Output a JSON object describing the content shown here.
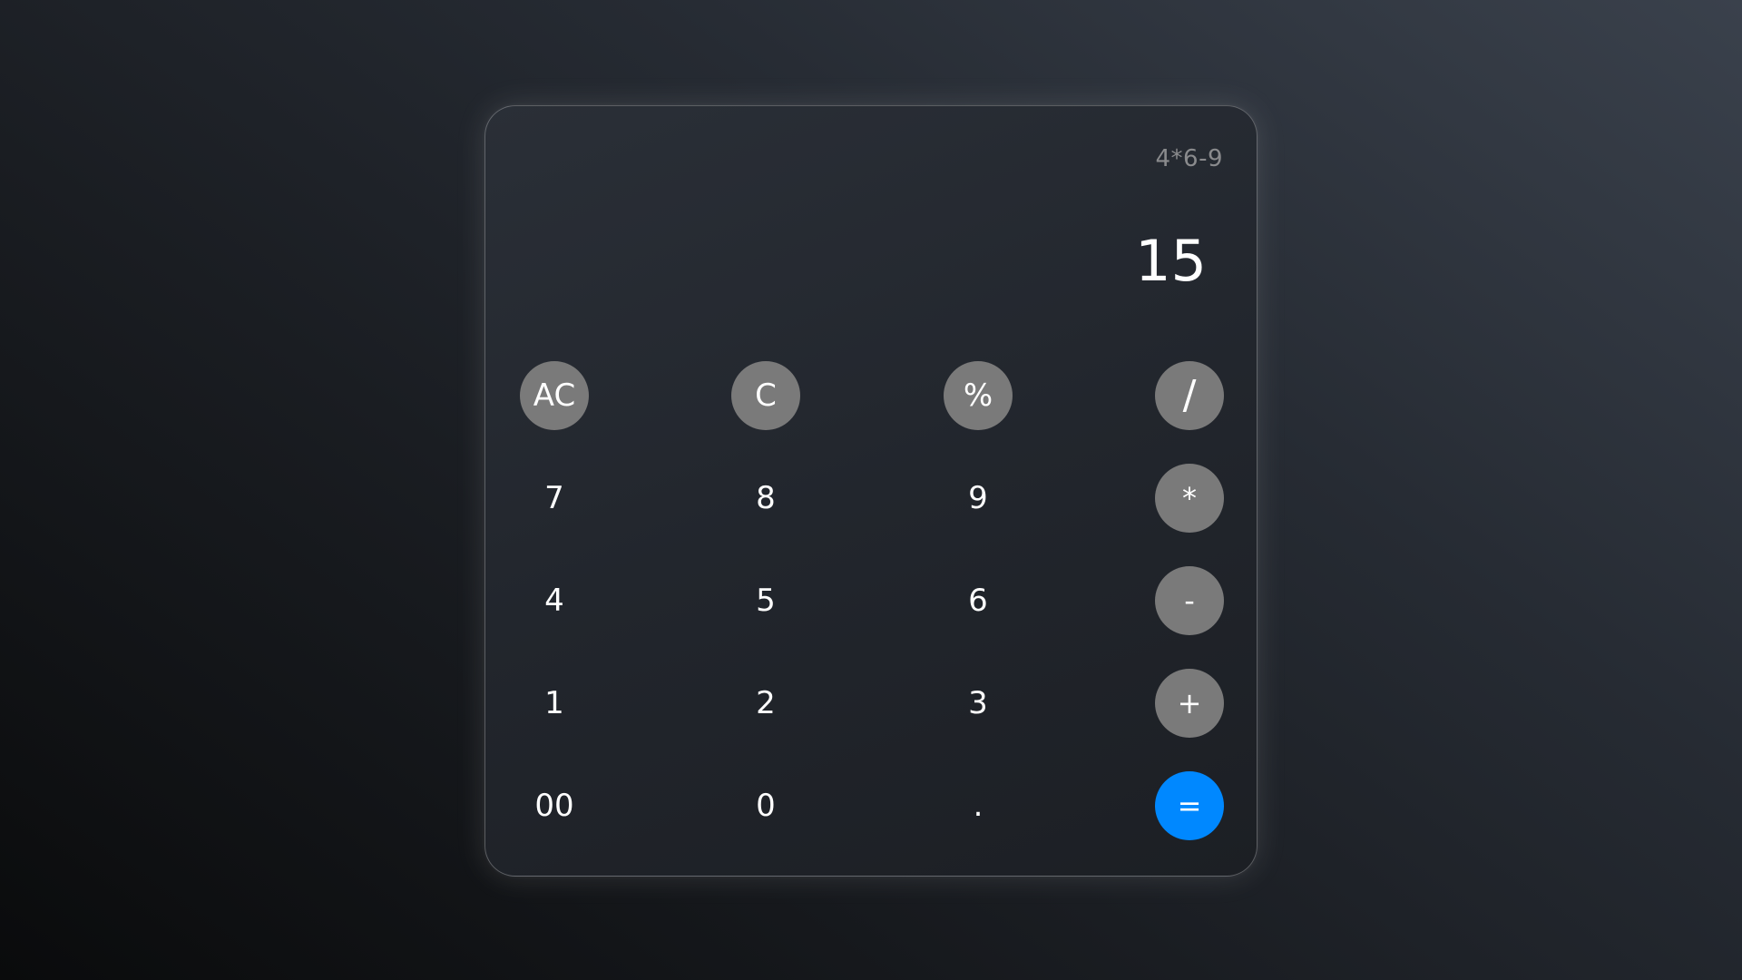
{
  "calculator": {
    "expression": "4*6-9",
    "result": "15",
    "keys": [
      {
        "label": "AC",
        "role": "clear-all"
      },
      {
        "label": "C",
        "role": "clear"
      },
      {
        "label": "%",
        "role": "percent"
      },
      {
        "label": "/",
        "role": "divide"
      },
      {
        "label": "7",
        "role": "digit"
      },
      {
        "label": "8",
        "role": "digit"
      },
      {
        "label": "9",
        "role": "digit"
      },
      {
        "label": "*",
        "role": "multiply"
      },
      {
        "label": "4",
        "role": "digit"
      },
      {
        "label": "5",
        "role": "digit"
      },
      {
        "label": "6",
        "role": "digit"
      },
      {
        "label": "-",
        "role": "subtract"
      },
      {
        "label": "1",
        "role": "digit"
      },
      {
        "label": "2",
        "role": "digit"
      },
      {
        "label": "3",
        "role": "digit"
      },
      {
        "label": "+",
        "role": "add"
      },
      {
        "label": "00",
        "role": "digit"
      },
      {
        "label": "0",
        "role": "digit"
      },
      {
        "label": ".",
        "role": "decimal"
      },
      {
        "label": "=",
        "role": "equals"
      }
    ]
  },
  "colors": {
    "function_key": "#7a7a7a",
    "equals_key": "#0088ff",
    "expression_text": "#8a8b8d",
    "result_text": "#ffffff"
  }
}
